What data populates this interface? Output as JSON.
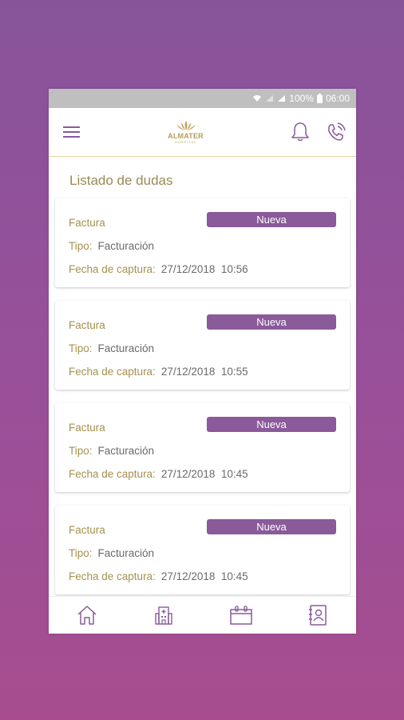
{
  "status_bar": {
    "battery": "100%",
    "time": "06:00"
  },
  "app_bar": {
    "logo_text": "ALMATER",
    "logo_sub": "HOSPITAL",
    "icons": [
      "menu-icon",
      "bell-icon",
      "phone-icon"
    ]
  },
  "section_title": "Listado de dudas",
  "cards": [
    {
      "title": "Factura",
      "status": "Nueva",
      "tipo_label": "Tipo:",
      "tipo_value": "Facturación",
      "fecha_label": "Fecha de captura:",
      "fecha_value": "27/12/2018  10:56"
    },
    {
      "title": "Factura",
      "status": "Nueva",
      "tipo_label": "Tipo:",
      "tipo_value": "Facturación",
      "fecha_label": "Fecha de captura:",
      "fecha_value": "27/12/2018  10:55"
    },
    {
      "title": "Factura",
      "status": "Nueva",
      "tipo_label": "Tipo:",
      "tipo_value": "Facturación",
      "fecha_label": "Fecha de captura:",
      "fecha_value": "27/12/2018  10:45"
    },
    {
      "title": "Factura",
      "status": "Nueva",
      "tipo_label": "Tipo:",
      "tipo_value": "Facturación",
      "fecha_label": "Fecha de captura:",
      "fecha_value": "27/12/2018  10:45"
    }
  ],
  "bottom_nav": [
    "home-icon",
    "hospital-icon",
    "calendar-icon",
    "contacts-icon"
  ],
  "colors": {
    "accent": "#8a5a9a",
    "gold": "#a5914f",
    "background_top": "#87549a",
    "background_bottom": "#a74d8f"
  }
}
